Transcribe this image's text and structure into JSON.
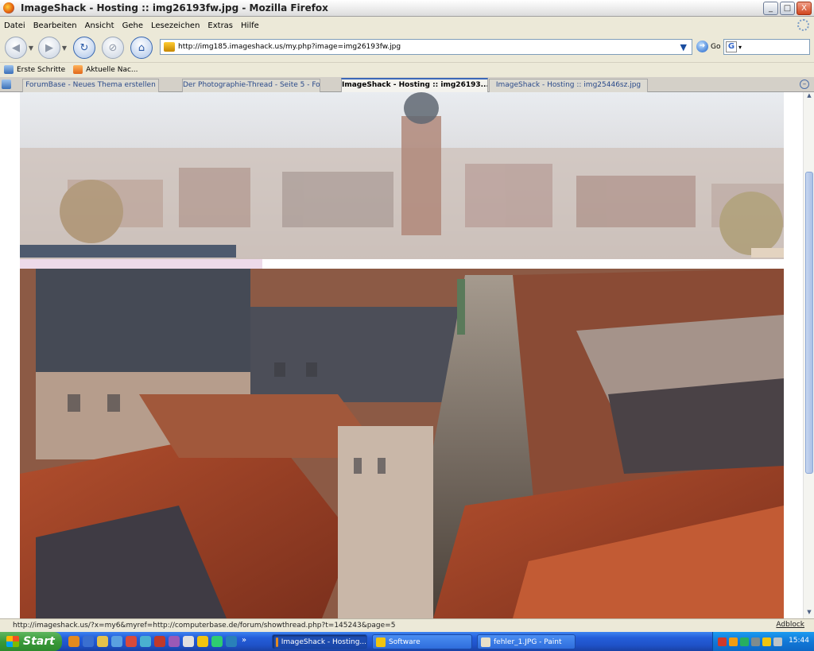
{
  "window": {
    "title": "ImageShack - Hosting :: img26193fw.jpg - Mozilla Firefox",
    "minimize": "_",
    "maximize": "□",
    "close": "X"
  },
  "menu": [
    "Datei",
    "Bearbeiten",
    "Ansicht",
    "Gehe",
    "Lesezeichen",
    "Extras",
    "Hilfe"
  ],
  "nav": {
    "url": "http://img185.imageshack.us/my.php?image=img26193fw.jpg",
    "go": "Go",
    "search_engine": "G"
  },
  "bookmarks": [
    "Erste Schritte",
    "Aktuelle Nac..."
  ],
  "tabs": [
    {
      "label": "ForumBase - Neues Thema erstellen",
      "active": false
    },
    {
      "label": "Der Photographie-Thread - Seite 5 - For...",
      "active": false
    },
    {
      "label": "ImageShack - Hosting :: img26193...",
      "active": true
    },
    {
      "label": "ImageShack - Hosting :: img25446sz.jpg",
      "active": false
    }
  ],
  "status": {
    "text": "http://imageshack.us/?x=my6&myref=http://computerbase.de/forum/showthread.php?t=145243&page=5",
    "adblock": "Adblock"
  },
  "taskbar": {
    "start": "Start",
    "chevron": "»",
    "items": [
      {
        "label": "ImageShack - Hosting...",
        "active": true
      },
      {
        "label": "Software",
        "active": false
      },
      {
        "label": "fehler_1.JPG - Paint",
        "active": false
      }
    ],
    "clock": "15:44"
  },
  "colors": {
    "accent": "#245edb",
    "tab_active_border": "#3c68b8",
    "start_green": "#3a9a3a"
  }
}
